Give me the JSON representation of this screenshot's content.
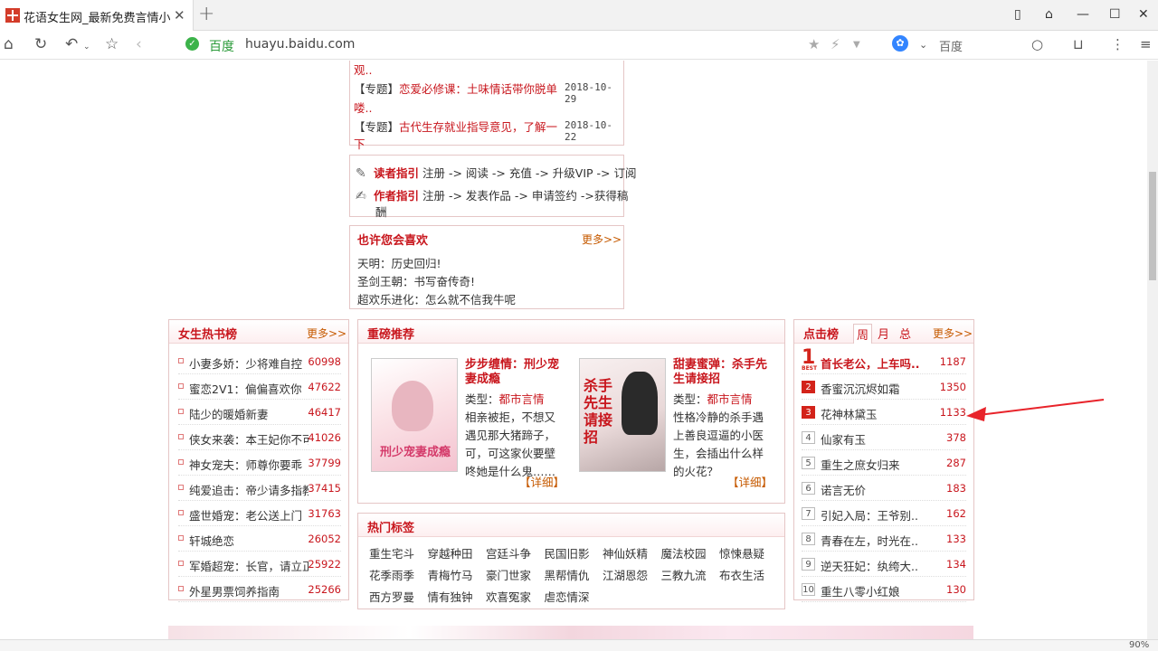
{
  "browser": {
    "tab_title": "花语女生网_最新免费言情小说",
    "site_name": "百度",
    "url": "huayu.baidu.com",
    "search_placeholder": "百度",
    "zoom": "90%"
  },
  "news": {
    "lines": [
      {
        "prefix": "",
        "text": "观..",
        "date": ""
      },
      {
        "prefix": "【专题】",
        "text": "恋爱必修课：土味情话带你脱单",
        "date": "2018-10-29"
      },
      {
        "prefix": "",
        "text": "喽..",
        "date": ""
      },
      {
        "prefix": "【专题】",
        "text": "古代生存就业指导意见，了解一",
        "date": "2018-10-22"
      },
      {
        "prefix": "",
        "text": "下",
        "date": ""
      }
    ]
  },
  "guide": {
    "reader_label": "读者指引",
    "reader_steps": "注册 -> 阅读 -> 充值 -> 升级VIP -> 订阅",
    "author_label": "作者指引",
    "author_steps": "注册 -> 发表作品 -> 申请签约 ->获得稿",
    "author_steps_cont": "酬"
  },
  "maybe_like": {
    "title": "也许您会喜欢",
    "more": "更多>>",
    "items": [
      "天明：历史回归!",
      "圣剑王朝：书写奋传奇!",
      "超欢乐进化：怎么就不信我牛呢"
    ]
  },
  "hot_list": {
    "title": "女生热书榜",
    "more": "更多>>",
    "items": [
      {
        "name": "小妻多娇：少将难自控",
        "count": "60998"
      },
      {
        "name": "蜜恋2V1：偏偏喜欢你",
        "count": "47622"
      },
      {
        "name": "陆少的暖婚新妻",
        "count": "46417"
      },
      {
        "name": "侠女来袭：本王妃你不可",
        "count": "41026"
      },
      {
        "name": "神女宠夫：师尊你要乖",
        "count": "37799"
      },
      {
        "name": "纯爱追击：帝少请多指教",
        "count": "37415"
      },
      {
        "name": "盛世婚宠：老公送上门",
        "count": "31763"
      },
      {
        "name": "轩城绝恋",
        "count": "26052"
      },
      {
        "name": "军婚超宠：长官，请立正",
        "count": "25922"
      },
      {
        "name": "外星男票饲养指南",
        "count": "25266"
      }
    ]
  },
  "recommend": {
    "title": "重磅推荐",
    "books": [
      {
        "title": "步步缠情：刑少宠妻成瘾",
        "type_label": "类型：",
        "type": "都市言情",
        "desc": "相亲被拒，不想又遇见那大猪蹄子，可，可这家伙要壁咚她是什么鬼……",
        "detail": "【详细】",
        "cover_text": "刑少宠妻成瘾"
      },
      {
        "title": "甜妻蜜弹：杀手先生请接招",
        "type_label": "类型：",
        "type": "都市言情",
        "desc": "性格冷静的杀手遇上善良逗逼的小医生，会插出什么样的火花？",
        "detail": "【详细】",
        "cover_text": "杀手先生请接招"
      }
    ]
  },
  "tags": {
    "title": "热门标签",
    "items": [
      "重生宅斗",
      "穿越种田",
      "宫廷斗争",
      "民国旧影",
      "神仙妖精",
      "魔法校园",
      "惊悚悬疑",
      "花季雨季",
      "青梅竹马",
      "豪门世家",
      "黑帮情仇",
      "江湖恩怨",
      "三教九流",
      "布衣生活",
      "西方罗曼",
      "情有独钟",
      "欢喜冤家",
      "虐恋情深"
    ]
  },
  "click_rank": {
    "title": "点击榜",
    "tabs": [
      "周",
      "月",
      "总"
    ],
    "more": "更多>>",
    "items": [
      {
        "rank": "1",
        "name": "首长老公，上车吗..",
        "count": "1187"
      },
      {
        "rank": "2",
        "name": "香蜜沉沉烬如霜",
        "count": "1350"
      },
      {
        "rank": "3",
        "name": "花神林黛玉",
        "count": "1133"
      },
      {
        "rank": "4",
        "name": "仙家有玉",
        "count": "378"
      },
      {
        "rank": "5",
        "name": "重生之庶女归来",
        "count": "287"
      },
      {
        "rank": "6",
        "name": "诺言无价",
        "count": "183"
      },
      {
        "rank": "7",
        "name": "引妃入局：王爷别..",
        "count": "162"
      },
      {
        "rank": "8",
        "name": "青春在左，时光在..",
        "count": "133"
      },
      {
        "rank": "9",
        "name": "逆天狂妃：纨绔大..",
        "count": "134"
      },
      {
        "rank": "10",
        "name": "重生八零小红娘",
        "count": "130"
      }
    ],
    "best_label": "BEST"
  },
  "colors": {
    "accent": "#c8161d",
    "more": "#c65a00",
    "arrow": "#e8232a"
  }
}
